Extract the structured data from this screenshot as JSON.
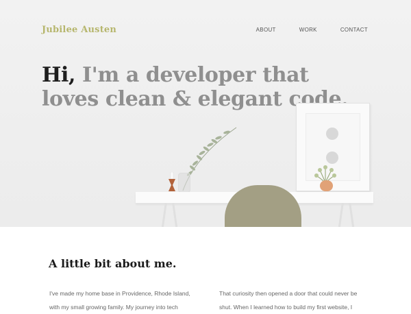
{
  "header": {
    "brand": "Jubilee Austen",
    "nav": [
      "ABOUT",
      "WORK",
      "CONTACT"
    ]
  },
  "hero": {
    "greeting": "Hi,",
    "headline_rest": " I'm a developer that loves clean & elegant code."
  },
  "about": {
    "title": "A little bit about me.",
    "col1_line1": "I've made my home base in Providence, Rhode Island,",
    "col1_line2": "with my small growing family. My journey into tech",
    "col2_line1": "That curiosity then opened a door that could never be",
    "col2_line2": "shut. When I learned how to build my first website, I"
  },
  "colors": {
    "brand": "#b6b66d",
    "headline_muted": "#8f8f8f",
    "headline_strong": "#1e1e1e"
  }
}
